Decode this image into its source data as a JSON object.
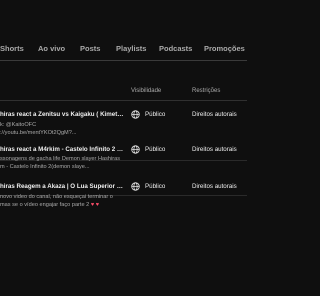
{
  "tabs": [
    {
      "label": "Shorts"
    },
    {
      "label": "Ao vivo"
    },
    {
      "label": "Posts"
    },
    {
      "label": "Playlists"
    },
    {
      "label": "Podcasts"
    },
    {
      "label": "Promoções"
    }
  ],
  "table": {
    "headers": {
      "visibility": "Visibilidade",
      "restrictions": "Restrições"
    },
    "rows": [
      {
        "title": "hiras react a Zenitsu vs Kaigaku ( Kimetsu ...",
        "desc1": "k: @KaitoOFC",
        "desc2": "://youtu.be/mentYKOt2QgM?...",
        "visibility": "Público",
        "restriction": "Direitos autorais"
      },
      {
        "title": "hiras react a M4rkim - Castelo Infinito 2 (A...",
        "desc1": "ssonagens de gacha life Demon slayer Hashiras",
        "desc2": "m - Castelo Infinito 2(demon slaye...",
        "visibility": "Público",
        "restriction": "Direitos autorais"
      },
      {
        "title": "hiras Reagem a Akaza | O Lua Superior 3 | ...",
        "desc1": "novo video do canal, não esqueçai terminar o",
        "desc2": "mas se o vídeo engajar faço parte 2",
        "desc2_hearts": "♥ ♥",
        "visibility": "Público",
        "restriction": "Direitos autorais"
      }
    ]
  },
  "icons": {
    "visibility": "globe-icon"
  },
  "colors": {
    "background": "#0f0f0f",
    "text_primary": "#f1f1f1",
    "text_secondary": "#aaaaaa",
    "heart": "#ff4e6a"
  }
}
